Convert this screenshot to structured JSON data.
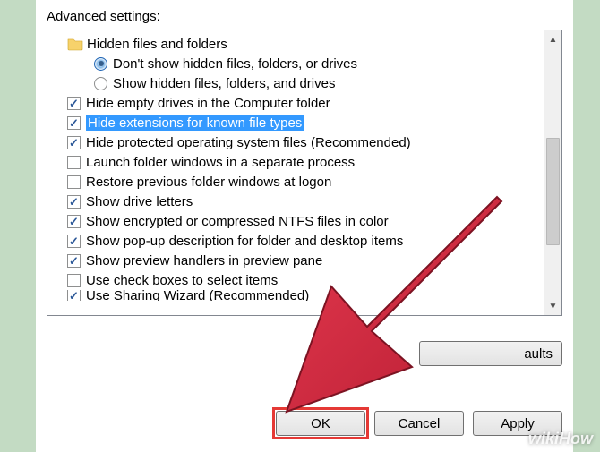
{
  "label": "Advanced settings:",
  "groupHeader": "Hidden files and folders",
  "radios": [
    {
      "label": "Don't show hidden files, folders, or drives",
      "selected": true
    },
    {
      "label": "Show hidden files, folders, and drives",
      "selected": false
    }
  ],
  "options": [
    {
      "label": "Hide empty drives in the Computer folder",
      "checked": true,
      "selected": false
    },
    {
      "label": "Hide extensions for known file types",
      "checked": true,
      "selected": true
    },
    {
      "label": "Hide protected operating system files (Recommended)",
      "checked": true,
      "selected": false
    },
    {
      "label": "Launch folder windows in a separate process",
      "checked": false,
      "selected": false
    },
    {
      "label": "Restore previous folder windows at logon",
      "checked": false,
      "selected": false
    },
    {
      "label": "Show drive letters",
      "checked": true,
      "selected": false
    },
    {
      "label": "Show encrypted or compressed NTFS files in color",
      "checked": true,
      "selected": false
    },
    {
      "label": "Show pop-up description for folder and desktop items",
      "checked": true,
      "selected": false
    },
    {
      "label": "Show preview handlers in preview pane",
      "checked": true,
      "selected": false
    },
    {
      "label": "Use check boxes to select items",
      "checked": false,
      "selected": false
    },
    {
      "label": "Use Sharing Wizard (Recommended)",
      "checked": true,
      "selected": false
    }
  ],
  "buttons": {
    "restoreDefaults": "aults",
    "ok": "OK",
    "cancel": "Cancel",
    "apply": "Apply"
  },
  "watermark": "wikiHow"
}
